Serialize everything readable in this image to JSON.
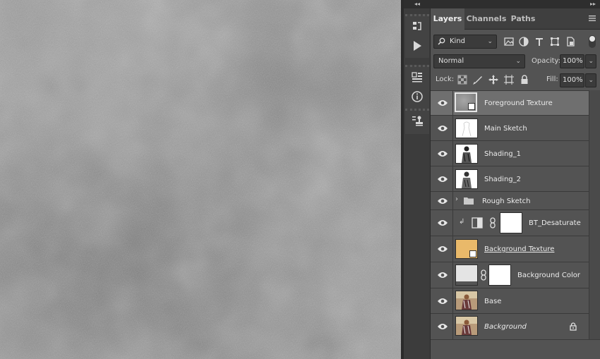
{
  "panel": {
    "tabs": [
      {
        "label": "Layers",
        "active": true
      },
      {
        "label": "Channels",
        "active": false
      },
      {
        "label": "Paths",
        "active": false
      }
    ],
    "filter": {
      "value": "Kind"
    },
    "blend_mode": {
      "value": "Normal"
    },
    "opacity": {
      "label": "Opacity:",
      "value": "100%"
    },
    "lock": {
      "label": "Lock:"
    },
    "fill": {
      "label": "Fill:",
      "value": "100%"
    }
  },
  "layers": [
    {
      "name": "Foreground Texture",
      "selected": true,
      "kind": "smart"
    },
    {
      "name": "Main Sketch",
      "kind": "sketch"
    },
    {
      "name": "Shading_1",
      "kind": "photo-bw"
    },
    {
      "name": "Shading_2",
      "kind": "photo-bw"
    },
    {
      "name": "Rough Sketch",
      "kind": "group"
    },
    {
      "name": "BT_Desaturate",
      "kind": "adjustment"
    },
    {
      "name": "Background Texture",
      "kind": "smart-color",
      "color": "#e9b96a"
    },
    {
      "name": "Background Color",
      "kind": "fill"
    },
    {
      "name": "Base",
      "kind": "photo"
    },
    {
      "name": "Background",
      "kind": "photo-locked"
    }
  ],
  "colors": {
    "panel_bg": "#535353",
    "selected_row": "#6f6f6f",
    "canvas_gray": "#9a9a9a",
    "tan_swatch": "#e9b96a"
  },
  "icons": [
    "play-icon",
    "history-icon",
    "info-icon",
    "properties-icon",
    "clone-stamp-icon",
    "search-icon",
    "eye-icon",
    "lock-icon",
    "folder-icon",
    "chevron-right-icon",
    "link-icon",
    "menu-icon"
  ]
}
